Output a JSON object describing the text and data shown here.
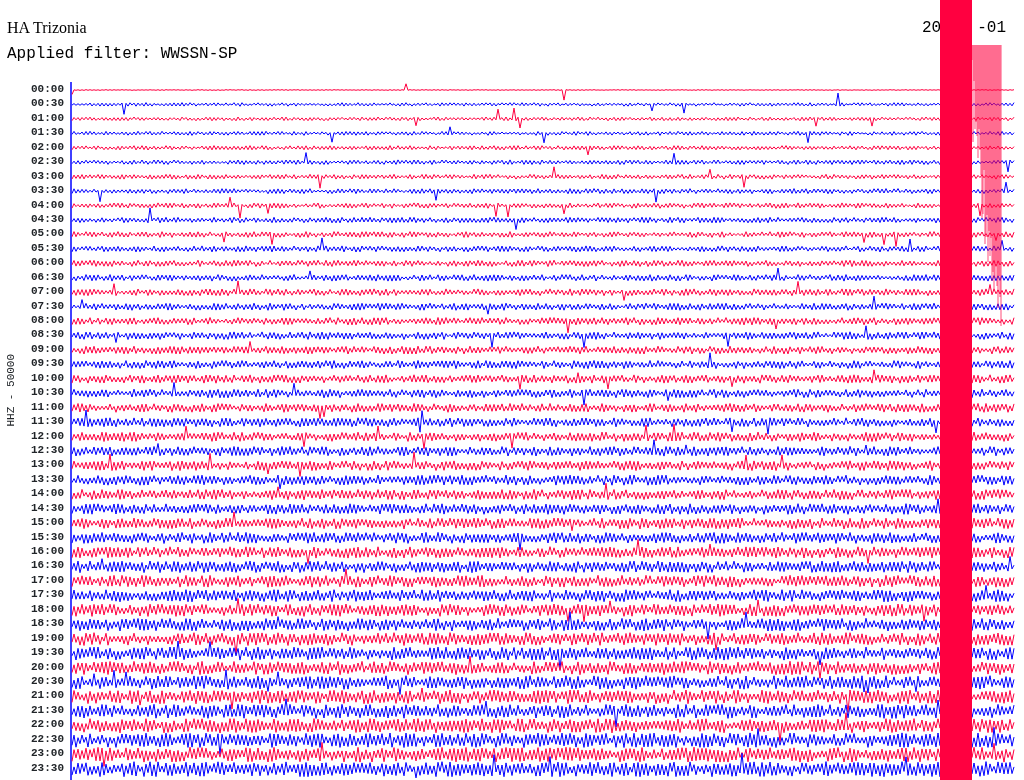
{
  "station": "HA Trizonia",
  "filter": "Applied filter: WWSSN-SP",
  "date_parts": [
    "20",
    "-01"
  ],
  "axis_label": "HHZ - 50000",
  "rows": [
    {
      "time": "00:00",
      "color": "#ff0040"
    },
    {
      "time": "00:30",
      "color": "#0000ff"
    },
    {
      "time": "01:00",
      "color": "#ff0040"
    },
    {
      "time": "01:30",
      "color": "#0000ff"
    },
    {
      "time": "02:00",
      "color": "#ff0040"
    },
    {
      "time": "02:30",
      "color": "#0000ff"
    },
    {
      "time": "03:00",
      "color": "#ff0040"
    },
    {
      "time": "03:30",
      "color": "#0000ff"
    },
    {
      "time": "04:00",
      "color": "#ff0040"
    },
    {
      "time": "04:30",
      "color": "#0000ff"
    },
    {
      "time": "05:00",
      "color": "#ff0040"
    },
    {
      "time": "05:30",
      "color": "#0000ff"
    },
    {
      "time": "06:00",
      "color": "#ff0040"
    },
    {
      "time": "06:30",
      "color": "#0000ff"
    },
    {
      "time": "07:00",
      "color": "#ff0040"
    },
    {
      "time": "07:30",
      "color": "#0000ff"
    },
    {
      "time": "08:00",
      "color": "#ff0040"
    },
    {
      "time": "08:30",
      "color": "#0000ff"
    },
    {
      "time": "09:00",
      "color": "#ff0040"
    },
    {
      "time": "09:30",
      "color": "#0000ff"
    },
    {
      "time": "10:00",
      "color": "#ff0040"
    },
    {
      "time": "10:30",
      "color": "#0000ff"
    },
    {
      "time": "11:00",
      "color": "#ff0040"
    },
    {
      "time": "11:30",
      "color": "#0000ff"
    },
    {
      "time": "12:00",
      "color": "#ff0040"
    },
    {
      "time": "12:30",
      "color": "#0000ff"
    },
    {
      "time": "13:00",
      "color": "#ff0040"
    },
    {
      "time": "13:30",
      "color": "#0000ff"
    },
    {
      "time": "14:00",
      "color": "#ff0040"
    },
    {
      "time": "14:30",
      "color": "#0000ff"
    },
    {
      "time": "15:00",
      "color": "#ff0040"
    },
    {
      "time": "15:30",
      "color": "#0000ff"
    },
    {
      "time": "16:00",
      "color": "#ff0040"
    },
    {
      "time": "16:30",
      "color": "#0000ff"
    },
    {
      "time": "17:00",
      "color": "#ff0040"
    },
    {
      "time": "17:30",
      "color": "#0000ff"
    },
    {
      "time": "18:00",
      "color": "#ff0040"
    },
    {
      "time": "18:30",
      "color": "#0000ff"
    },
    {
      "time": "19:00",
      "color": "#ff0040"
    },
    {
      "time": "19:30",
      "color": "#0000ff"
    },
    {
      "time": "20:00",
      "color": "#ff0040"
    },
    {
      "time": "20:30",
      "color": "#0000ff"
    },
    {
      "time": "21:00",
      "color": "#ff0040"
    },
    {
      "time": "21:30",
      "color": "#0000ff"
    },
    {
      "time": "22:00",
      "color": "#ff0040"
    },
    {
      "time": "22:30",
      "color": "#0000ff"
    },
    {
      "time": "23:00",
      "color": "#ff0040"
    },
    {
      "time": "23:30",
      "color": "#0000ff"
    }
  ]
}
